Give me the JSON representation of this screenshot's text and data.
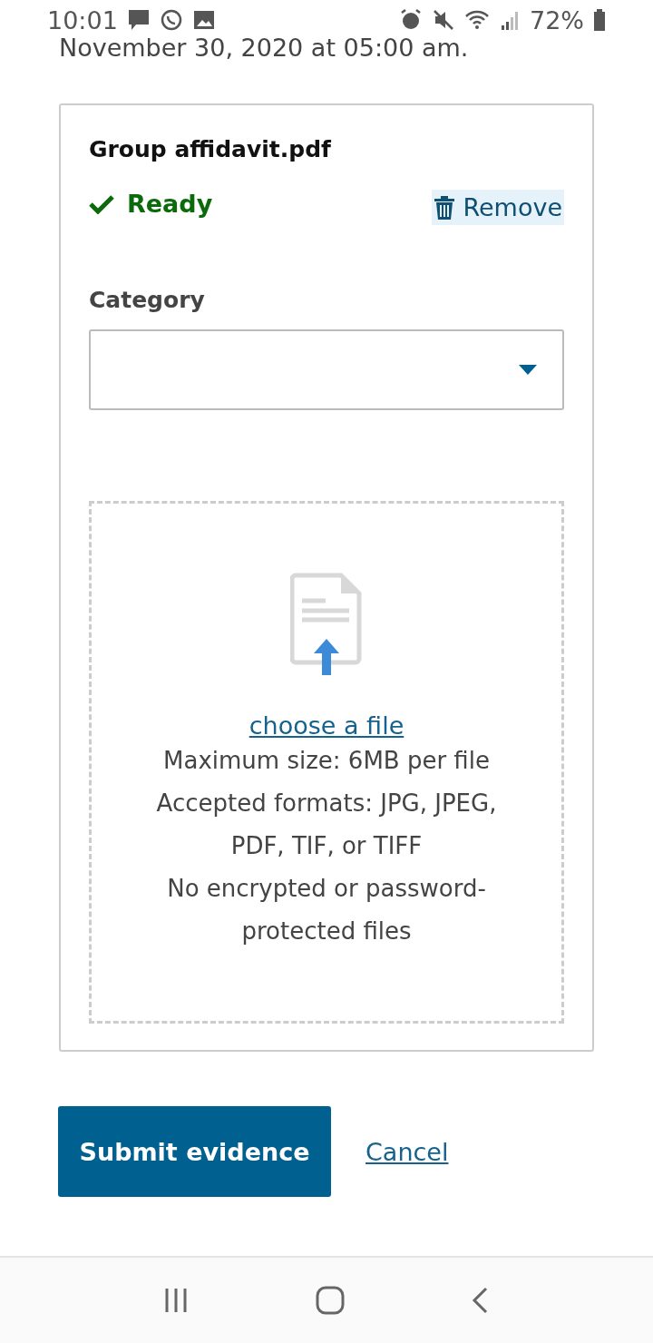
{
  "status_bar": {
    "time": "10:01",
    "battery": "72%"
  },
  "deadline_text": "November 30, 2020 at 05:00 am.",
  "upload": {
    "file_name": "Group affidavit.pdf",
    "status": "Ready",
    "remove_label": "Remove",
    "category": {
      "label": "Category"
    },
    "dropzone": {
      "link": "choose a file",
      "lines": [
        "Maximum size: 6MB per file",
        "Accepted formats: JPG, JPEG, PDF, TIF, or TIFF",
        "No encrypted or password-protected files"
      ]
    }
  },
  "actions": {
    "submit": "Submit evidence",
    "cancel": "Cancel"
  }
}
